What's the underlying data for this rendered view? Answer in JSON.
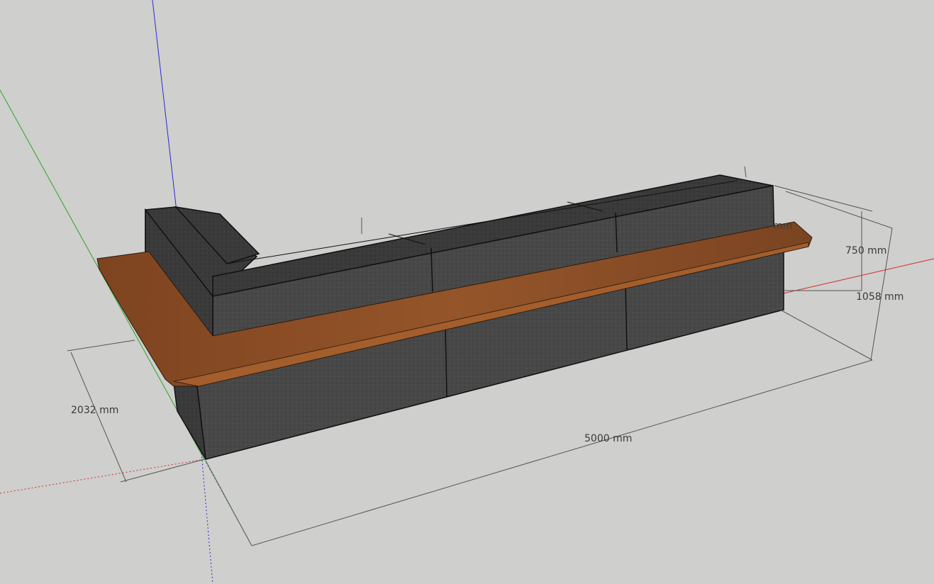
{
  "dimensions": {
    "depth": "2032 mm",
    "length": "5000 mm",
    "counter_height": "750 mm",
    "back_height": "1058 mm",
    "partial_label": "mm"
  },
  "colors": {
    "background": "#cfcfcd",
    "axis_red": "#d22b2b",
    "axis_green": "#2aa52a",
    "axis_blue": "#2a2ad2",
    "fabric": "#4a4a4a",
    "wood": "#8a4a20"
  },
  "icons": {
    "axes": "sketchup-axes-icon"
  }
}
